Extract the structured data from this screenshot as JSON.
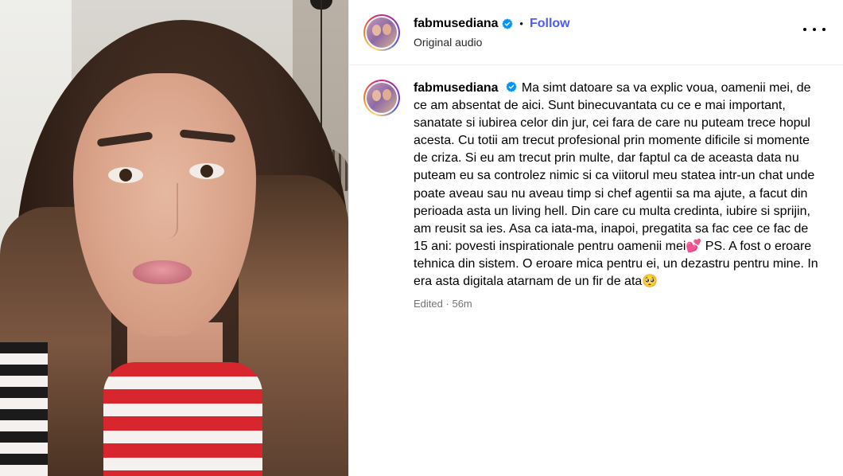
{
  "post": {
    "username": "fabmusediana",
    "separator": "•",
    "follow_label": "Follow",
    "audio_label": "Original audio",
    "caption_text": "Ma simt datoare sa va explic voua, oamenii mei, de ce am absentat de aici. Sunt binecuvantata cu ce e mai important, sanatate si iubirea celor din jur, cei fara de care nu puteam trece hopul acesta. Cu totii am trecut profesional prin momente dificile si momente de criza. Si eu am trecut prin multe, dar faptul ca de aceasta data nu puteam eu sa controlez nimic si ca viitorul meu statea intr-un chat unde poate aveau sau nu aveau timp si chef agentii sa ma ajute, a facut din perioada asta un living hell. Din care cu multa credinta, iubire si sprijin, am reusit sa ies. Asa ca iata-ma, inapoi, pregatita sa fac cee ce fac de 15 ani: povesti inspirationale pentru oamenii mei💕  PS. A fost o eroare tehnica din sistem. O eroare mica pentru ei, un dezastru pentru mine. In era asta digitala atarnam de un fir de ata🥺",
    "edited_label": "Edited",
    "meta_separator": "·",
    "timestamp": "56m"
  },
  "colors": {
    "follow": "#4a5df9",
    "verified": "#0095f6",
    "meta": "#737373"
  },
  "icons": {
    "verified": "verified-badge-icon",
    "more": "more-options-icon"
  }
}
